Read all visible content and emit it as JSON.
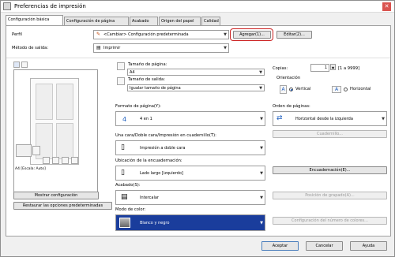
{
  "window": {
    "title": "Preferencias de impresión",
    "close": "✕"
  },
  "tabs": [
    {
      "label": "Configuración básica"
    },
    {
      "label": "Configuración de página"
    },
    {
      "label": "Acabado"
    },
    {
      "label": "Origen del papel"
    },
    {
      "label": "Calidad"
    }
  ],
  "profile": {
    "label": "Perfil",
    "value": "<Cambiar> Configuración predeterminada",
    "add_button": "Agregar(1)...",
    "edit_button": "Editar(2)..."
  },
  "output_method": {
    "label": "Método de salida:",
    "value": "Imprimir"
  },
  "page_size": {
    "label": "Tamaño de página:",
    "value": "A4"
  },
  "output_size": {
    "label": "Tamaño de salida:",
    "value": "Igualar tamaño de página"
  },
  "copies": {
    "label": "Copias:",
    "value": "1",
    "range": "[1 a 9999]"
  },
  "orientation": {
    "label": "Orientación",
    "vertical": "Vertical",
    "horizontal": "Horizontal",
    "icon_a": "A"
  },
  "page_format": {
    "label": "Formato de página(Y):",
    "value": "4 en 1",
    "icon_num": "4"
  },
  "page_order": {
    "label": "Orden de páginas:",
    "value": "Horizontal desde la izquierda"
  },
  "details_button": "Cuadernillo...",
  "print_mode": {
    "label": "Una cara/Doble cara/Impresión en cuadernillo(T):",
    "value": "Impresión a doble cara"
  },
  "binding_location": {
    "label": "Ubicación de la encuadernación:",
    "value": "Lado largo [izquierdo]"
  },
  "binding_button": "Encuadernación(E)...",
  "finishing": {
    "label": "Acabado(S):",
    "value": "Intercalar"
  },
  "staple_button": "Posición de grapado(A)...",
  "color_mode": {
    "label": "Modo de color:",
    "value": "Blanco y negro"
  },
  "color_count_button": "Configuración del número de colores...",
  "preview": {
    "caption": "A4 [Escala: Auto]"
  },
  "left_buttons": {
    "show_settings": "Mostrar configuración",
    "restore_defaults": "Restaurar las opciones predeterminadas"
  },
  "footer": {
    "ok": "Aceptar",
    "cancel": "Cancelar",
    "help": "Ayuda"
  },
  "colors": {
    "highlight": "#cc2222",
    "color_bar": "#1a3d9c",
    "accent": "#2060c0"
  }
}
